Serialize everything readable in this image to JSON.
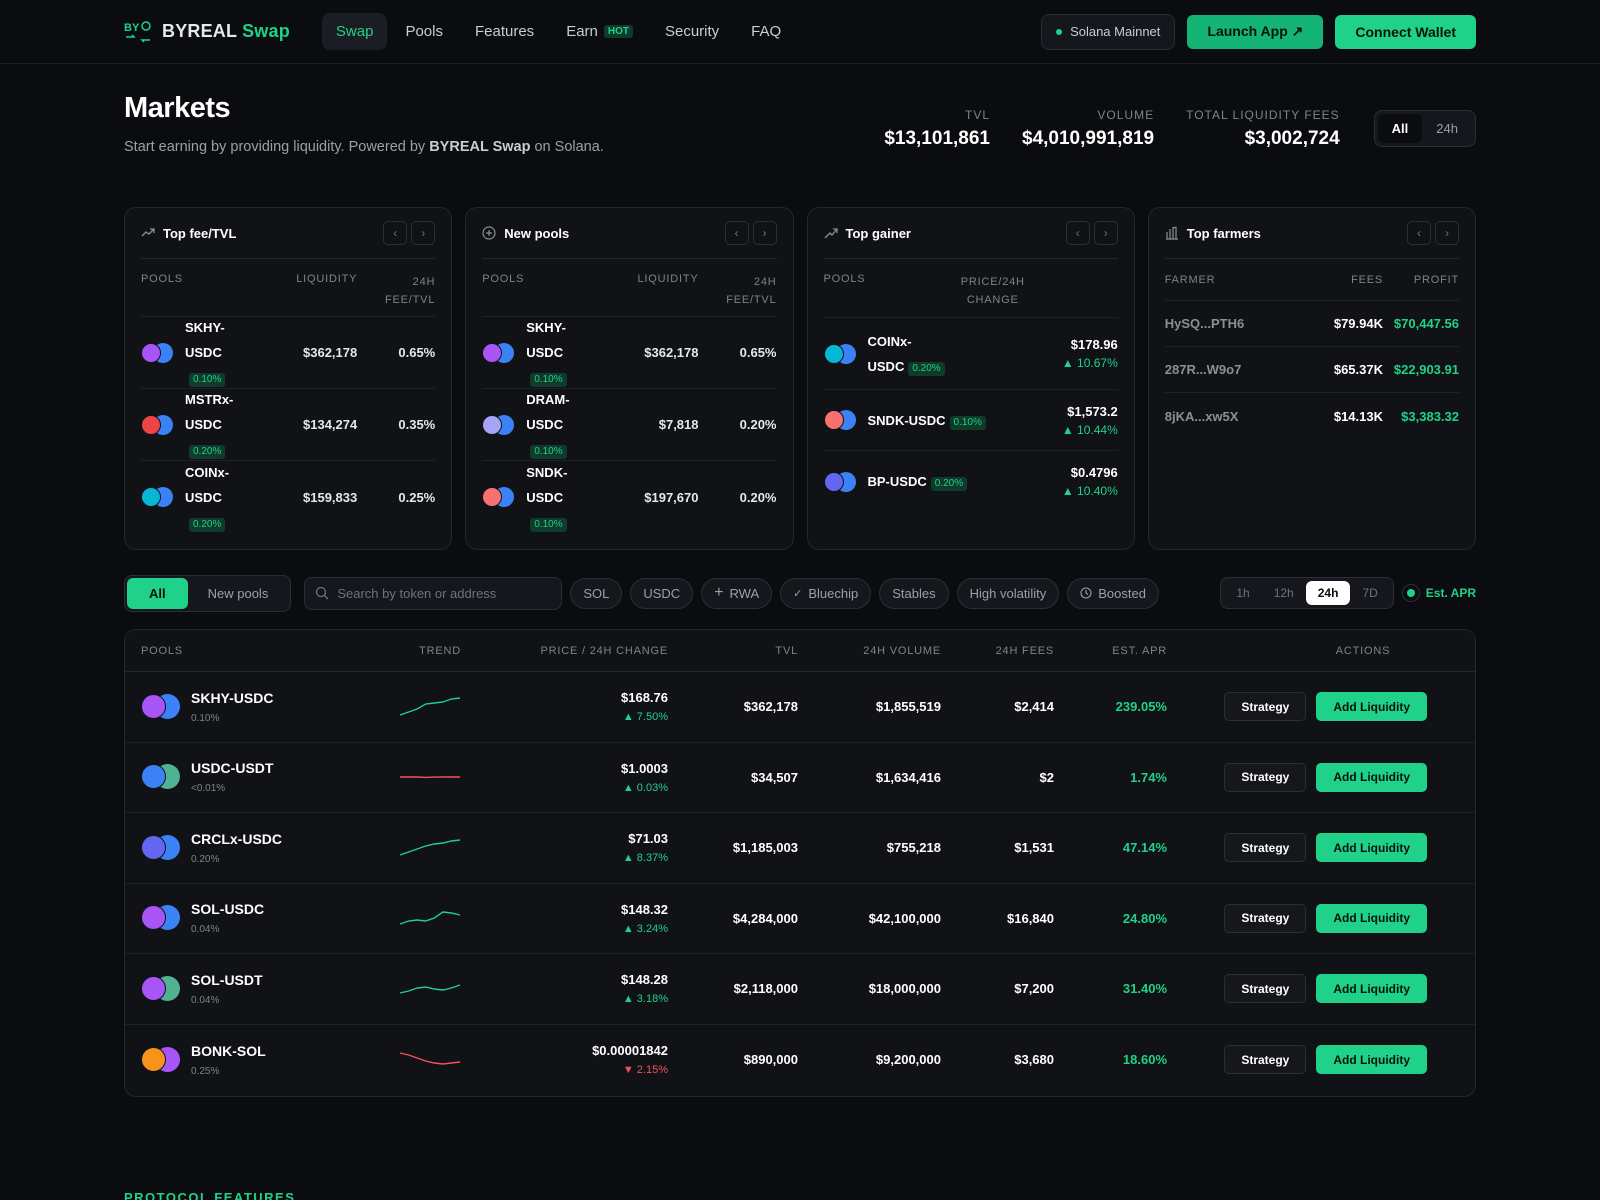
{
  "brand": {
    "name": "BYREAL",
    "suffix": "Swap",
    "mark": "BY"
  },
  "nav": {
    "items": [
      {
        "label": "Swap",
        "active": true
      },
      {
        "label": "Pools"
      },
      {
        "label": "Features"
      },
      {
        "label": "Earn",
        "badge": "HOT"
      },
      {
        "label": "Security"
      },
      {
        "label": "FAQ"
      }
    ],
    "network": "Solana Mainnet",
    "launch": "Launch App ↗",
    "connect": "Connect Wallet"
  },
  "markets": {
    "title": "Markets",
    "subtitle_pre": "Start earning by providing liquidity. Powered by ",
    "subtitle_bold": "BYREAL Swap",
    "subtitle_post": " on Solana.",
    "stats": [
      {
        "label": "TVL",
        "value": "$13,101,861"
      },
      {
        "label": "VOLUME",
        "value": "$4,010,991,819"
      },
      {
        "label": "TOTAL LIQUIDITY FEES",
        "value": "$3,002,724"
      }
    ],
    "range": [
      "All",
      "24h"
    ]
  },
  "cards": {
    "top_fee": {
      "title": "Top fee/TVL",
      "headers": [
        "POOLS",
        "LIQUIDITY",
        "24H",
        "FEE/TVL"
      ],
      "rows": [
        {
          "line1": "SKHY-",
          "line2": "USDC",
          "fee": "0.10%",
          "liq": "$362,178",
          "ratio": "0.65%",
          "c1": "#a855f7",
          "c2": "#3b82f6"
        },
        {
          "line1": "MSTRx-",
          "line2": "USDC",
          "fee": "0.20%",
          "liq": "$134,274",
          "ratio": "0.35%",
          "c1": "#ef4444",
          "c2": "#3b82f6"
        },
        {
          "line1": "COINx-",
          "line2": "USDC",
          "fee": "0.20%",
          "liq": "$159,833",
          "ratio": "0.25%",
          "c1": "#06b6d4",
          "c2": "#3b82f6"
        }
      ]
    },
    "new_pools": {
      "title": "New pools",
      "headers": [
        "POOLS",
        "LIQUIDITY",
        "24H",
        "FEE/TVL"
      ],
      "rows": [
        {
          "line1": "SKHY-",
          "line2": "USDC",
          "fee": "0.10%",
          "liq": "$362,178",
          "ratio": "0.65%",
          "c1": "#a855f7",
          "c2": "#3b82f6"
        },
        {
          "line1": "DRAM-",
          "line2": "USDC",
          "fee": "0.10%",
          "liq": "$7,818",
          "ratio": "0.20%",
          "c1": "#a5a4f5",
          "c2": "#3b82f6"
        },
        {
          "line1": "SNDK-",
          "line2": "USDC",
          "fee": "0.10%",
          "liq": "$197,670",
          "ratio": "0.20%",
          "c1": "#f87171",
          "c2": "#3b82f6"
        }
      ]
    },
    "top_gainer": {
      "title": "Top gainer",
      "headers": [
        "POOLS",
        "PRICE/24H",
        "CHANGE"
      ],
      "rows": [
        {
          "line1": "COINx-",
          "line2": "USDC",
          "fee": "0.20%",
          "price": "$178.96",
          "change": "▲ 10.67%",
          "c1": "#06b6d4",
          "c2": "#3b82f6"
        },
        {
          "line1": "SNDK-USDC",
          "line2": "",
          "fee": "0.10%",
          "price": "$1,573.2",
          "change": "▲ 10.44%",
          "c1": "#f87171",
          "c2": "#3b82f6"
        },
        {
          "line1": "BP-USDC",
          "line2": "",
          "fee": "0.20%",
          "price": "$0.4796",
          "change": "▲ 10.40%",
          "c1": "#6366f1",
          "c2": "#3b82f6"
        }
      ]
    },
    "top_farmers": {
      "title": "Top farmers",
      "headers": [
        "FARMER",
        "FEES",
        "PROFIT"
      ],
      "rows": [
        {
          "farmer": "HySQ...PTH6",
          "fees": "$79.94K",
          "profit": "$70,447.56"
        },
        {
          "farmer": "287R...W9o7",
          "fees": "$65.37K",
          "profit": "$22,903.91"
        },
        {
          "farmer": "8jKA...xw5X",
          "fees": "$14.13K",
          "profit": "$3,383.32"
        }
      ]
    }
  },
  "filters": {
    "tabs": [
      "All",
      "New pools"
    ],
    "search_placeholder": "Search by token or address",
    "chips": [
      "SOL",
      "USDC",
      "RWA",
      "Bluechip",
      "Stables",
      "High volatility",
      "Boosted"
    ],
    "timeframes": [
      "1h",
      "12h",
      "24h",
      "7D"
    ],
    "timeframe_selected": "24h",
    "apr_toggle": "Est. APR"
  },
  "table": {
    "headers": [
      "POOLS",
      "TREND",
      "PRICE / 24H CHANGE",
      "TVL",
      "24H VOLUME",
      "24H FEES",
      "EST. APR",
      "ACTIONS"
    ],
    "strategy_label": "Strategy",
    "add_label": "Add Liquidity",
    "rows": [
      {
        "pool": "SKHY-USDC",
        "fee": "0.10%",
        "price": "$168.76",
        "change": "▲ 7.50%",
        "dir": "up",
        "tvl": "$362,178",
        "vol": "$1,855,519",
        "fees": "$2,414",
        "apr": "239.05%",
        "c1": "#a855f7",
        "c2": "#3b82f6",
        "trend": [
          20,
          17,
          14,
          9,
          8,
          7,
          4,
          3
        ]
      },
      {
        "pool": "USDC-USDT",
        "fee": "<0.01%",
        "price": "$1.0003",
        "change": "▲ 0.03%",
        "dir": "flat",
        "tvl": "$34,507",
        "vol": "$1,634,416",
        "fees": "$2",
        "apr": "1.74%",
        "c1": "#3b82f6",
        "c2": "#4fb391",
        "trend": [
          12,
          12,
          12,
          12.4,
          12.1,
          12,
          12,
          12
        ]
      },
      {
        "pool": "CRCLx-USDC",
        "fee": "0.20%",
        "price": "$71.03",
        "change": "▲ 8.37%",
        "dir": "up",
        "tvl": "$1,185,003",
        "vol": "$755,218",
        "fees": "$1,531",
        "apr": "47.14%",
        "c1": "#6366f1",
        "c2": "#3b82f6",
        "trend": [
          19,
          16,
          13,
          10,
          8,
          7,
          5,
          4
        ]
      },
      {
        "pool": "SOL-USDC",
        "fee": "0.04%",
        "price": "$148.32",
        "change": "▲ 3.24%",
        "dir": "up",
        "tvl": "$4,284,000",
        "vol": "$42,100,000",
        "fees": "$16,840",
        "apr": "24.80%",
        "c1": "#a855f7",
        "c2": "#3b82f6",
        "trend": [
          18,
          15,
          14,
          15,
          12,
          6,
          7,
          9
        ]
      },
      {
        "pool": "SOL-USDT",
        "fee": "0.04%",
        "price": "$148.28",
        "change": "▲ 3.18%",
        "dir": "up",
        "tvl": "$2,118,000",
        "vol": "$18,000,000",
        "fees": "$7,200",
        "apr": "31.40%",
        "c1": "#a855f7",
        "c2": "#4fb391",
        "trend": [
          16,
          14,
          11,
          10,
          12,
          13,
          11,
          8
        ]
      },
      {
        "pool": "BONK-SOL",
        "fee": "0.25%",
        "price": "$0.00001842",
        "change": "▼ 2.15%",
        "dir": "down",
        "tvl": "$890,000",
        "vol": "$9,200,000",
        "fees": "$3,680",
        "apr": "18.60%",
        "c1": "#f7931a",
        "c2": "#a855f7",
        "trend": [
          5,
          7,
          10,
          13,
          15,
          16,
          15,
          14
        ]
      }
    ]
  },
  "footer_peek": "PROTOCOL FEATURES",
  "colors": {
    "accent": "#1fd189",
    "negative": "#f2515d",
    "bg": "#0b0c0f",
    "card": "#111216"
  }
}
